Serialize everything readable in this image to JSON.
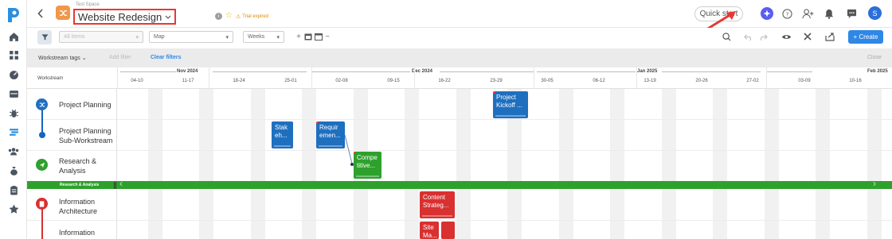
{
  "app": {
    "workspace_label": "Test Space",
    "project_title": "Website Redesign",
    "trial_status": "Trial expired",
    "avatar_initial": "S",
    "quick_start_label": "Quick start",
    "create_label": "+ Create"
  },
  "toolbar": {
    "items_select": "All items",
    "view_select": "Map",
    "scale_select": "Weeks"
  },
  "filterbar": {
    "tags_label": "Workstream tags",
    "add_filter": "Add filter",
    "clear_filters": "Clear filters",
    "close": "Close"
  },
  "timeline": {
    "workstream_header": "Workstream",
    "months": [
      "Nov 2024",
      "Dec 2024",
      "Jan 2025",
      "Feb 2025"
    ],
    "weeks": [
      "04-10",
      "11-17",
      "18-24",
      "25-01",
      "02-08",
      "09-15",
      "16-22",
      "23-29",
      "30-05",
      "06-12",
      "13-19",
      "20-26",
      "27-02",
      "03-09",
      "10-16"
    ]
  },
  "rows": [
    {
      "label": "Project Planning"
    },
    {
      "label": "Project Planning Sub-Workstream"
    },
    {
      "label": "Research & Analysis"
    },
    {
      "label": "Information Architecture"
    },
    {
      "label": "Information Architecture Sub-"
    }
  ],
  "band_label": "Research & Analysis",
  "tasks": [
    {
      "label": "Project Kickoff ..."
    },
    {
      "label": "Stak eh..."
    },
    {
      "label": "Requir emen..."
    },
    {
      "label": "Compe titive..."
    },
    {
      "label": "Content Strateg..."
    },
    {
      "label": "Site Ma..."
    }
  ],
  "colors": {
    "accent": "#2f87e6",
    "workstream_blue": "#1f6fbf",
    "research_green": "#2ea12c",
    "ia_red": "#d93030",
    "highlight_red": "#e53935"
  }
}
